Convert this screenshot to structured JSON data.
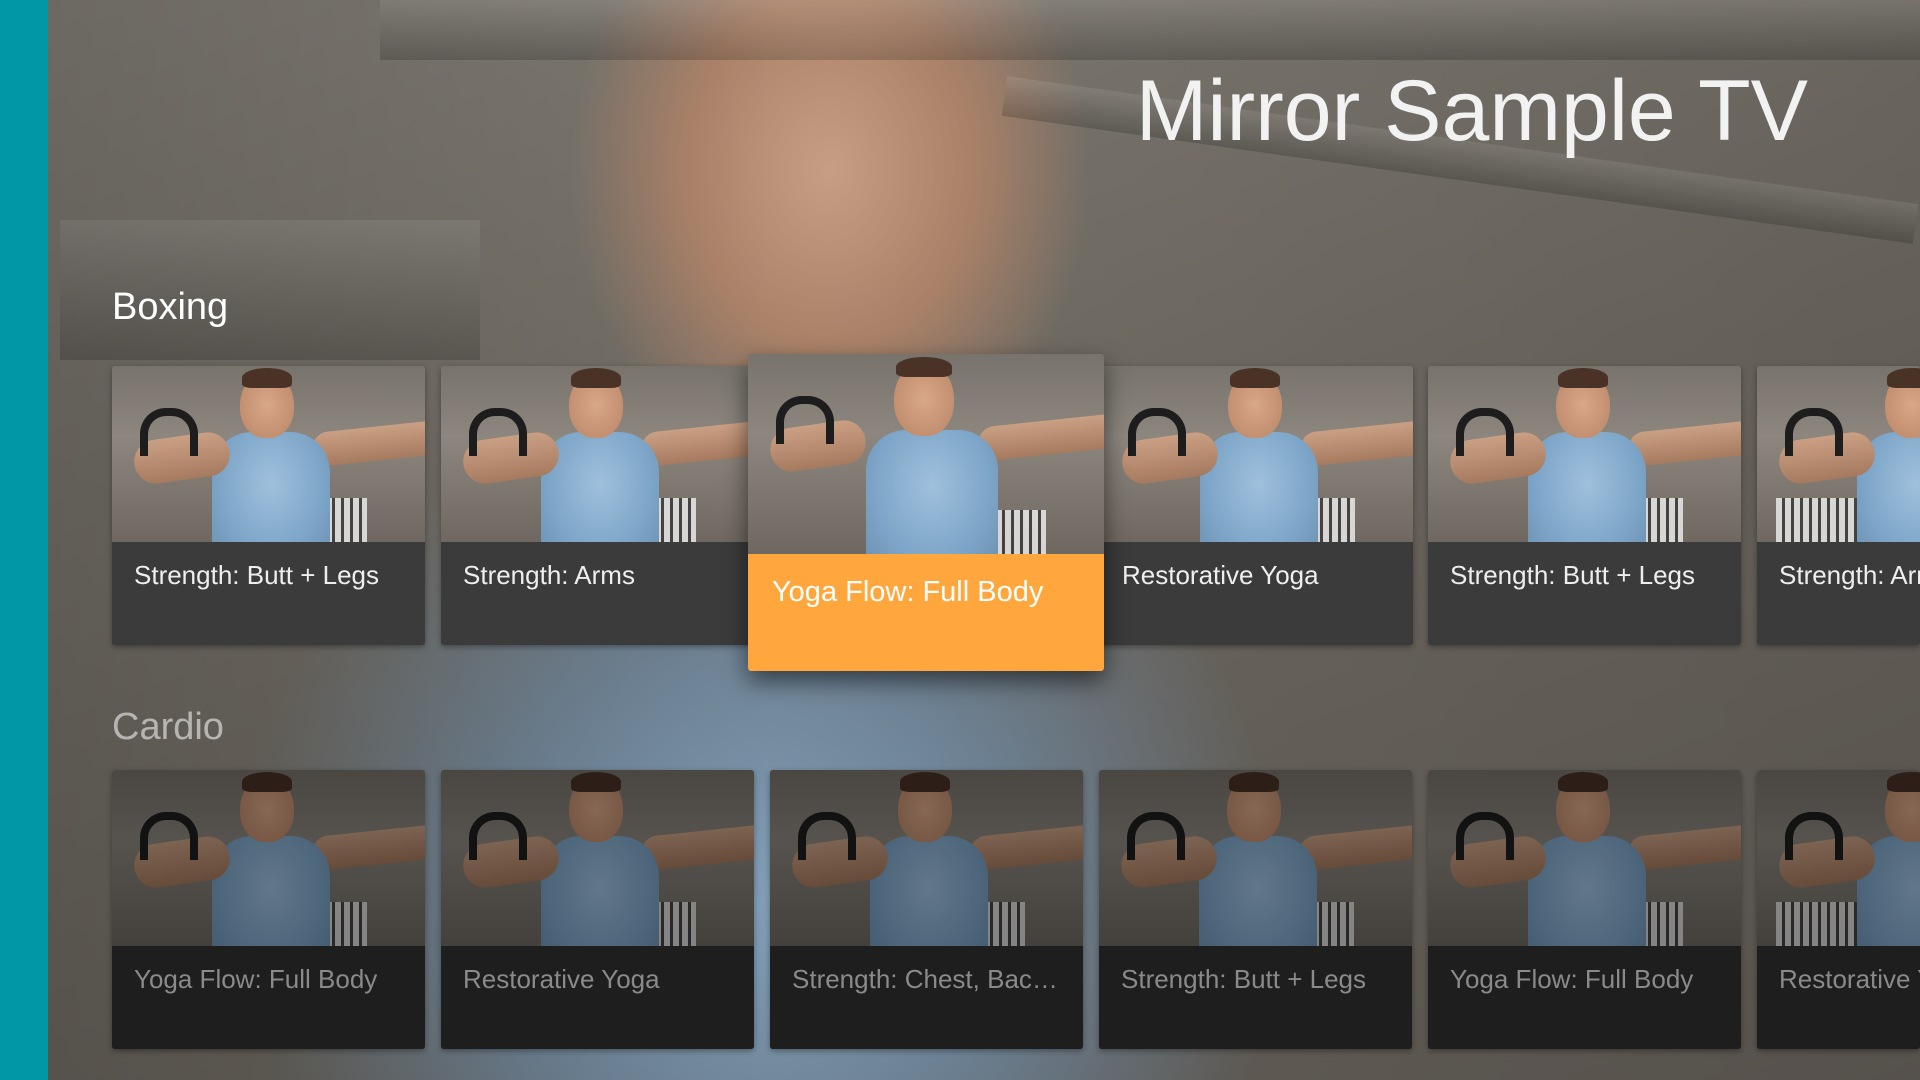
{
  "app": {
    "title": "Mirror Sample TV"
  },
  "colors": {
    "rail": "#0097a7",
    "focus_accent": "#ffa63d",
    "card_bg": "#3b3b3b",
    "card_bg_dim": "#1e1e1e"
  },
  "rows": [
    {
      "header": "Boxing",
      "cards": [
        {
          "title": "Strength: Butt + Legs",
          "focused": false
        },
        {
          "title": "Strength: Arms",
          "focused": false
        },
        {
          "title": "Yoga Flow: Full Body",
          "focused": true
        },
        {
          "title": "Restorative Yoga",
          "focused": false
        },
        {
          "title": "Strength: Butt + Legs",
          "focused": false
        },
        {
          "title": "Strength: Arms",
          "focused": false
        }
      ]
    },
    {
      "header": "Cardio",
      "cards": [
        {
          "title": "Yoga Flow: Full Body",
          "focused": false
        },
        {
          "title": "Restorative Yoga",
          "focused": false
        },
        {
          "title": "Strength: Chest, Back ...",
          "focused": false
        },
        {
          "title": "Strength: Butt + Legs",
          "focused": false
        },
        {
          "title": "Yoga Flow: Full Body",
          "focused": false
        },
        {
          "title": "Restorative Yoga",
          "focused": false
        }
      ]
    }
  ],
  "icons": {
    "card_thumbnail": "workout-trainer-image"
  }
}
